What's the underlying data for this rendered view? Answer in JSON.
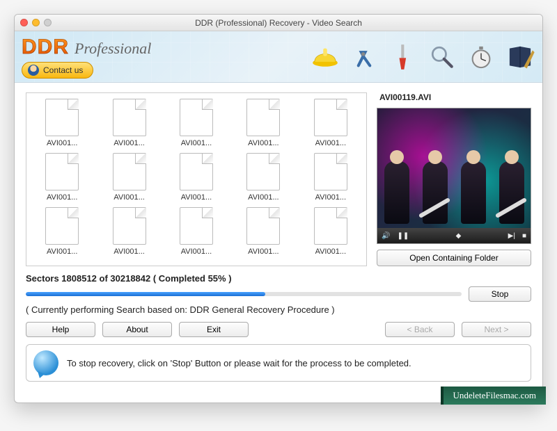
{
  "window": {
    "title": "DDR (Professional) Recovery - Video Search"
  },
  "header": {
    "brand_bold": "DDR",
    "brand_sub": "Professional",
    "contact_label": "Contact us"
  },
  "files": [
    "AVI001...",
    "AVI001...",
    "AVI001...",
    "AVI001...",
    "AVI001...",
    "AVI001...",
    "AVI001...",
    "AVI001...",
    "AVI001...",
    "AVI001...",
    "AVI001...",
    "AVI001...",
    "AVI001...",
    "AVI001...",
    "AVI001..."
  ],
  "preview": {
    "filename": "AVI00119.AVI",
    "open_folder_label": "Open Containing Folder"
  },
  "progress": {
    "sectors_current": "1808512",
    "sectors_total": "30218842",
    "percent": 55,
    "label_template": "Sectors 1808512 of 30218842   ( Completed 55% )",
    "stop_label": "Stop",
    "status_line": "( Currently performing Search based on: DDR General Recovery Procedure )"
  },
  "buttons": {
    "help": "Help",
    "about": "About",
    "exit": "Exit",
    "back": "< Back",
    "next": "Next >"
  },
  "hint": {
    "text": "To stop recovery, click on 'Stop' Button or please wait for the process to be completed."
  },
  "watermark": "UndeleteFilesmac.com"
}
